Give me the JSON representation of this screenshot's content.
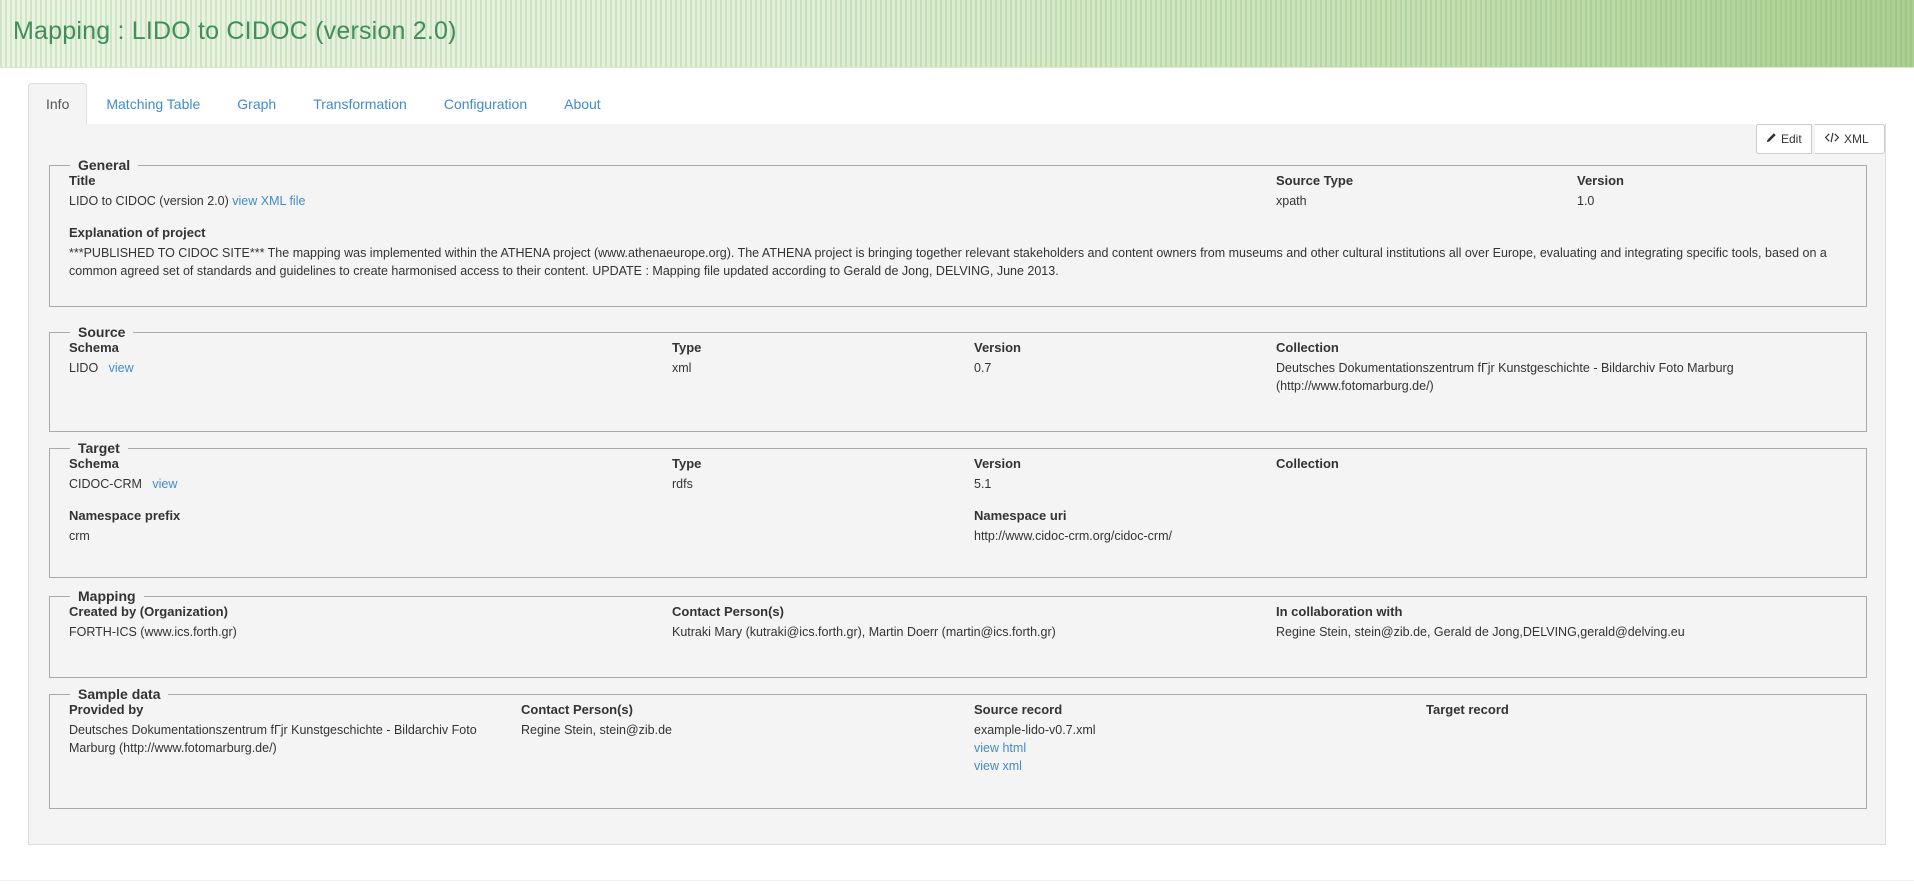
{
  "header": {
    "title": "Mapping : LIDO to CIDOC (version 2.0)"
  },
  "tabs": [
    {
      "label": "Info",
      "active": true
    },
    {
      "label": "Matching Table"
    },
    {
      "label": "Graph"
    },
    {
      "label": "Transformation"
    },
    {
      "label": "Configuration"
    },
    {
      "label": "About"
    }
  ],
  "toolbar": {
    "edit_label": "Edit",
    "xml_label": "XML"
  },
  "general": {
    "legend": "General",
    "title_label": "Title",
    "title_value": "LIDO to CIDOC (version 2.0)",
    "view_xml_link": "view XML file",
    "source_type_label": "Source Type",
    "source_type_value": "xpath",
    "version_label": "Version",
    "version_value": "1.0",
    "explanation_label": "Explanation of project",
    "explanation_value": "***PUBLISHED TO CIDOC SITE*** The mapping was implemented within the ATHENA project (www.athenaeurope.org). The ATHENA project is bringing together relevant stakeholders and content owners from museums and other cultural institutions all over Europe, evaluating and integrating specific tools, based on a common agreed set of standards and guidelines to create harmonised access to their content. UPDATE : Mapping file updated according to Gerald de Jong, DELVING, June 2013."
  },
  "source": {
    "legend": "Source",
    "schema_label": "Schema",
    "schema_value": "LIDO",
    "view_link": "view",
    "type_label": "Type",
    "type_value": "xml",
    "version_label": "Version",
    "version_value": "0.7",
    "collection_label": "Collection",
    "collection_value": "Deutsches Dokumentationszentrum fГјr Kunstgeschichte - Bildarchiv Foto Marburg (http://www.fotomarburg.de/)"
  },
  "target": {
    "legend": "Target",
    "schema_label": "Schema",
    "schema_value": "CIDOC-CRM",
    "view_link": "view",
    "type_label": "Type",
    "type_value": "rdfs",
    "version_label": "Version",
    "version_value": "5.1",
    "collection_label": "Collection",
    "ns_prefix_label": "Namespace prefix",
    "ns_prefix_value": "crm",
    "ns_uri_label": "Namespace uri",
    "ns_uri_value": "http://www.cidoc-crm.org/cidoc-crm/"
  },
  "mapping": {
    "legend": "Mapping",
    "created_label": "Created by (Organization)",
    "created_value": "FORTH-ICS (www.ics.forth.gr)",
    "contact_label": "Contact Person(s)",
    "contact_value": "Kutraki Mary (kutraki@ics.forth.gr), Martin Doerr (martin@ics.forth.gr)",
    "collab_label": "In collaboration with",
    "collab_value": "Regine Stein, stein@zib.de, Gerald de Jong,DELVING,gerald@delving.eu"
  },
  "sample": {
    "legend": "Sample data",
    "provided_label": "Provided by",
    "provided_value": "Deutsches Dokumentationszentrum fГјr Kunstgeschichte - Bildarchiv Foto Marburg (http://www.fotomarburg.de/)",
    "contact_label": "Contact Person(s)",
    "contact_value": "Regine Stein, stein@zib.de",
    "source_record_label": "Source record",
    "source_record_value": "example-lido-v0.7.xml",
    "view_html_link": "view html",
    "view_xml_link": "view xml",
    "target_record_label": "Target record"
  },
  "icons": {
    "edit": "pencil-icon",
    "xml": "code-icon"
  },
  "colors": {
    "title": "#3f8f57",
    "link": "#428bca",
    "panel": "#f4f4f4"
  }
}
